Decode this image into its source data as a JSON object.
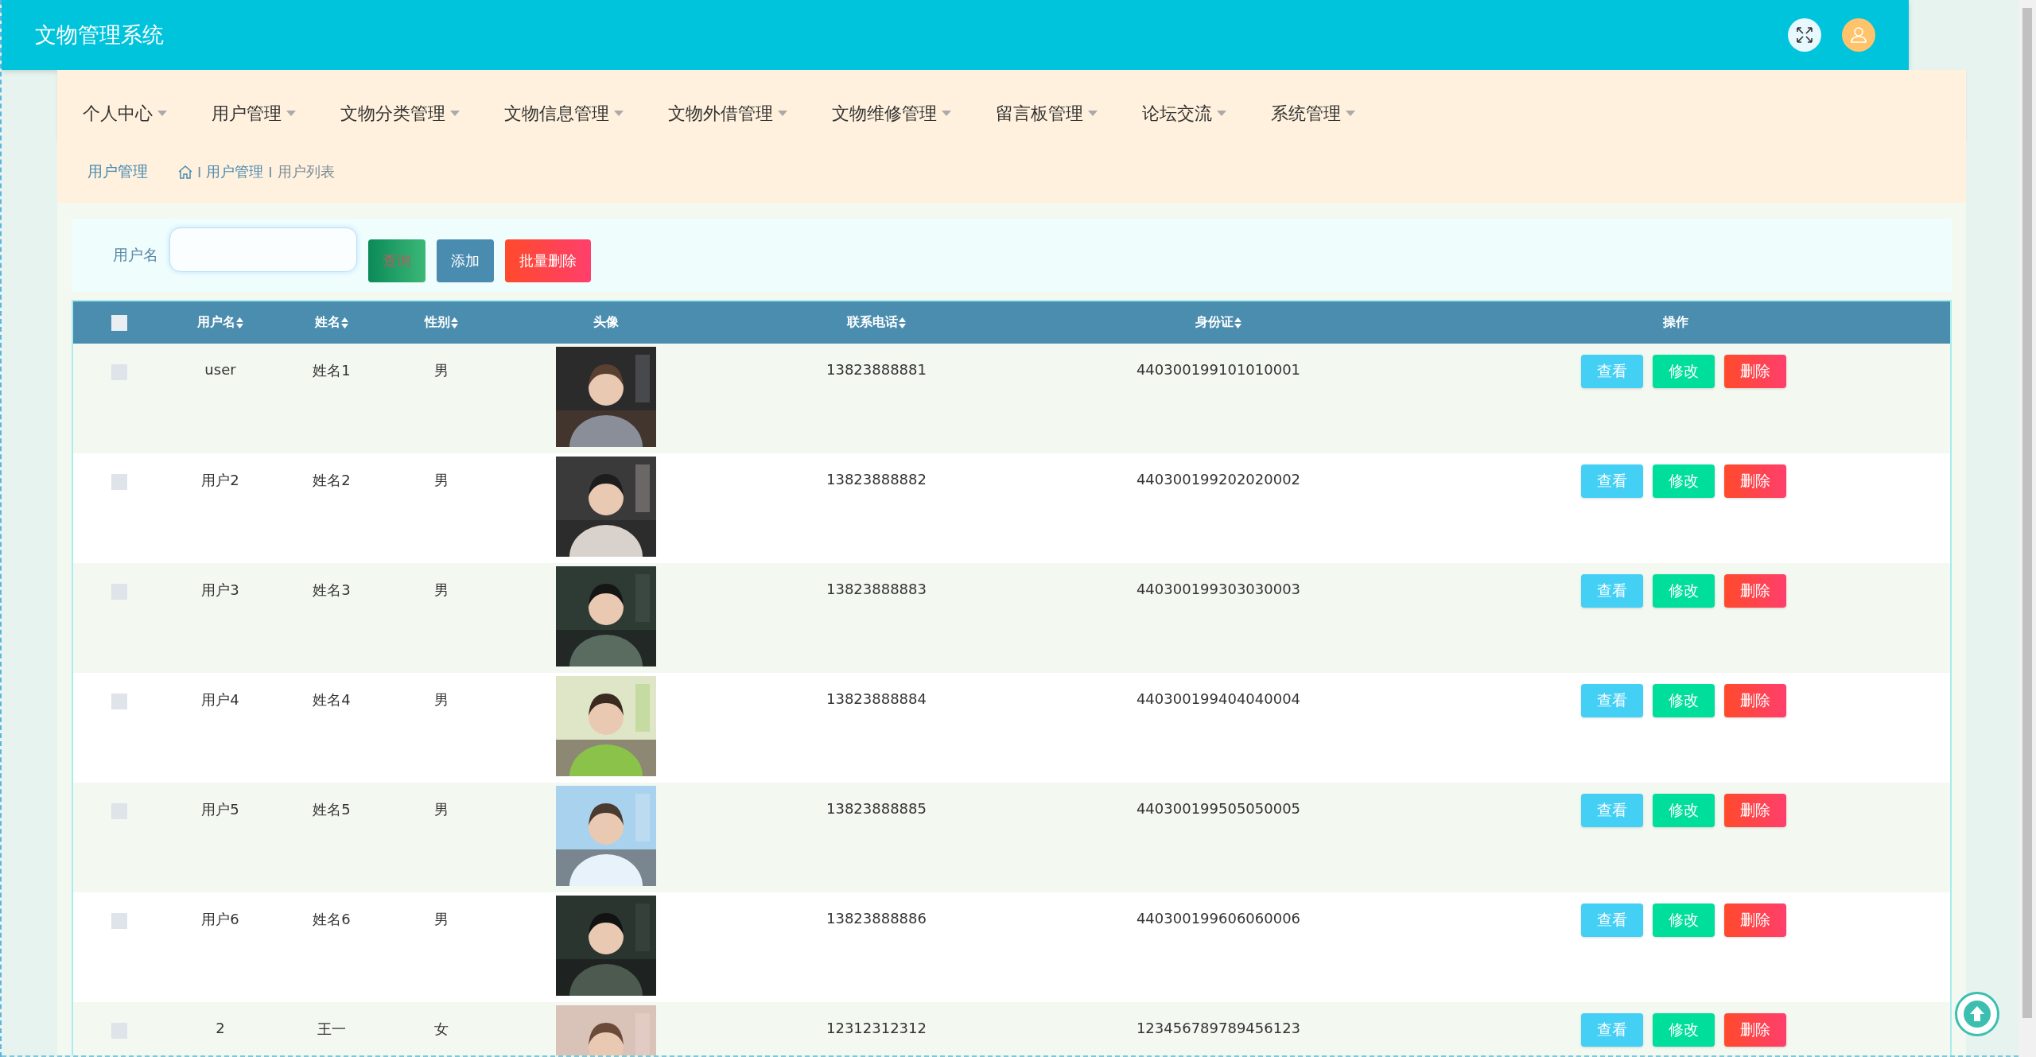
{
  "header": {
    "title": "文物管理系统"
  },
  "nav": [
    {
      "label": "个人中心"
    },
    {
      "label": "用户管理"
    },
    {
      "label": "文物分类管理"
    },
    {
      "label": "文物信息管理"
    },
    {
      "label": "文物外借管理"
    },
    {
      "label": "文物维修管理"
    },
    {
      "label": "留言板管理"
    },
    {
      "label": "论坛交流"
    },
    {
      "label": "系统管理"
    }
  ],
  "breadcrumb": {
    "title": "用户管理",
    "path": [
      {
        "separator": "I",
        "label": "用户管理"
      },
      {
        "separator": "I",
        "label": "用户列表"
      }
    ]
  },
  "search": {
    "label": "用户名",
    "buttons": [
      {
        "label": "查询",
        "kind": "query"
      },
      {
        "label": "添加",
        "kind": "add"
      },
      {
        "label": "批量删除",
        "kind": "delete"
      }
    ]
  },
  "table": {
    "select_all": {
      "checked": false
    },
    "columns": [
      {
        "label": "用户名",
        "sortable": true
      },
      {
        "label": "姓名",
        "sortable": true
      },
      {
        "label": "性别",
        "sortable": true
      },
      {
        "label": "头像",
        "sortable": false
      },
      {
        "label": "联系电话",
        "sortable": true
      },
      {
        "label": "身份证",
        "sortable": true
      },
      {
        "label": "操作",
        "sortable": false
      }
    ],
    "rows": [
      {
        "checked": false,
        "username": "user",
        "name": "姓名1",
        "sex": "男",
        "phone": "13823888881",
        "id_card": "440300199101010001",
        "actions": [
          "查看",
          "修改",
          "删除"
        ]
      },
      {
        "checked": false,
        "username": "用户2",
        "name": "姓名2",
        "sex": "男",
        "phone": "13823888882",
        "id_card": "440300199202020002",
        "actions": [
          "查看",
          "修改",
          "删除"
        ]
      },
      {
        "checked": false,
        "username": "用户3",
        "name": "姓名3",
        "sex": "男",
        "phone": "13823888883",
        "id_card": "440300199303030003",
        "actions": [
          "查看",
          "修改",
          "删除"
        ]
      },
      {
        "checked": false,
        "username": "用户4",
        "name": "姓名4",
        "sex": "男",
        "phone": "13823888884",
        "id_card": "440300199404040004",
        "actions": [
          "查看",
          "修改",
          "删除"
        ]
      },
      {
        "checked": false,
        "username": "用户5",
        "name": "姓名5",
        "sex": "男",
        "phone": "13823888885",
        "id_card": "440300199505050005",
        "actions": [
          "查看",
          "修改",
          "删除"
        ]
      },
      {
        "checked": false,
        "username": "用户6",
        "name": "姓名6",
        "sex": "男",
        "phone": "13823888886",
        "id_card": "440300199606060006",
        "actions": [
          "查看",
          "修改",
          "删除"
        ]
      },
      {
        "checked": false,
        "username": "2",
        "name": "王一",
        "sex": "女",
        "phone": "12312312312",
        "id_card": "123456789789456123",
        "actions": [
          "查看",
          "修改",
          "删除"
        ]
      }
    ]
  }
}
